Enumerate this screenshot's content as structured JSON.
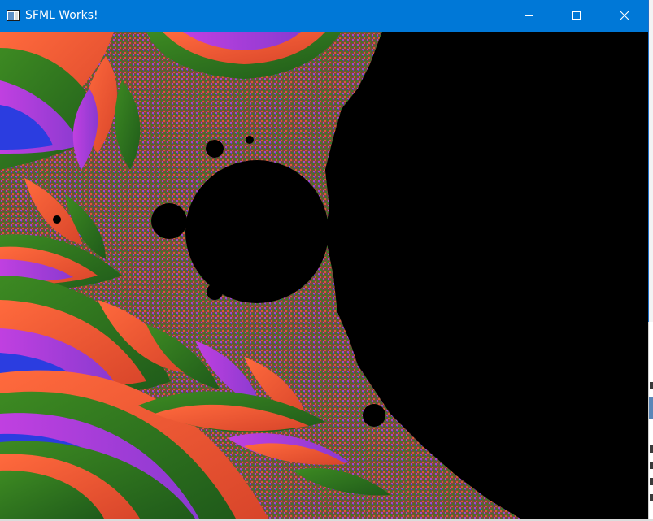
{
  "window": {
    "title": "SFML Works!",
    "app_icon": "window-app-icon",
    "controls": {
      "minimize": "minimize-icon",
      "maximize": "maximize-icon",
      "close": "close-icon"
    }
  },
  "canvas": {
    "content": "mandelbrot-fractal",
    "palette": [
      "#2e7d1f",
      "#f25a32",
      "#b23ad6",
      "#2b3de0",
      "#000000"
    ]
  },
  "colors": {
    "titlebar": "#0078d7",
    "title_text": "#ffffff",
    "set_interior": "#000000"
  }
}
